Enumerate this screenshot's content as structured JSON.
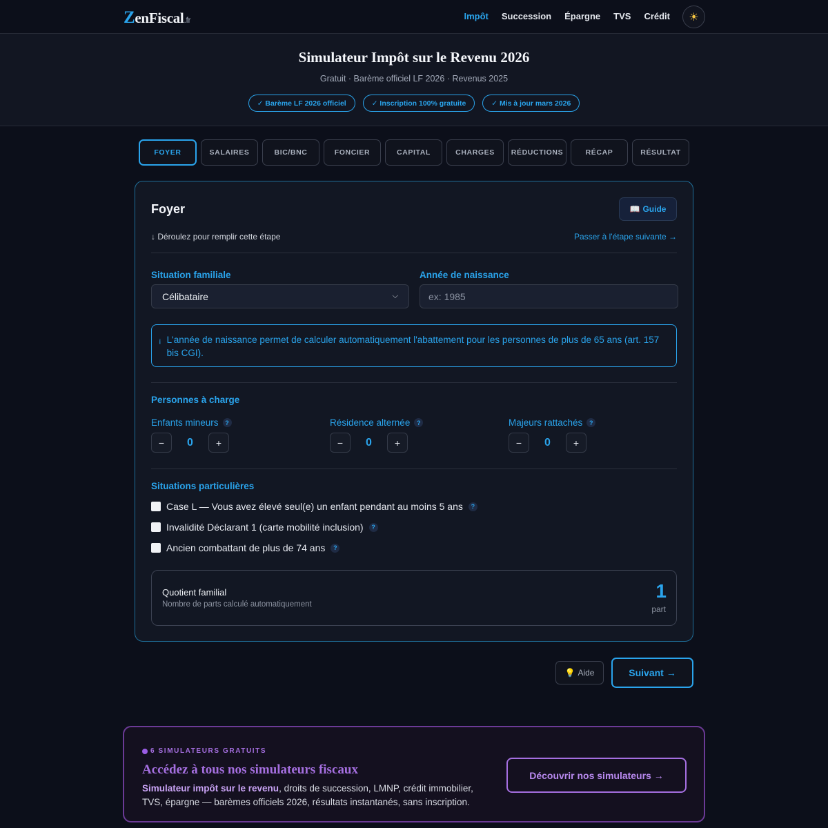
{
  "nav": {
    "logo_z": "Z",
    "logo_rest": "enFiscal",
    "logo_tld": ".fr",
    "links": [
      "Impôt",
      "Succession",
      "Épargne",
      "TVS",
      "Crédit"
    ],
    "active_link": "Impôt",
    "theme_icon": "sun-icon"
  },
  "hero": {
    "title": "Simulateur Impôt sur le Revenu 2026",
    "subtitle": "Gratuit · Barème officiel LF 2026 · Revenus 2025",
    "badges": [
      "✓ Barème LF 2026 officiel",
      "✓ Inscription 100% gratuite",
      "✓ Mis à jour mars 2026"
    ]
  },
  "tabs": [
    "FOYER",
    "SALAIRES",
    "BIC/BNC",
    "FONCIER",
    "CAPITAL",
    "CHARGES",
    "RÉDUCTIONS",
    "RÉCAP",
    "RÉSULTAT"
  ],
  "active_tab": "FOYER",
  "card": {
    "title": "Foyer",
    "guide_label": "Guide",
    "hint": "↓ Déroulez pour remplir cette étape",
    "next_link": "Passer à l'étape suivante →",
    "situation_label": "Situation familiale",
    "situation_value": "Célibataire",
    "birth_label": "Année de naissance",
    "birth_placeholder": "ex: 1985",
    "info_text": "L'année de naissance permet de calculer automatiquement l'abattement pour les personnes de plus de 65 ans (art. 157 bis CGI).",
    "dependents_title": "Personnes à charge",
    "counters": [
      {
        "label": "Enfants mineurs",
        "value": "0"
      },
      {
        "label": "Résidence alternée",
        "value": "0"
      },
      {
        "label": "Majeurs rattachés",
        "value": "0"
      }
    ],
    "special_title": "Situations particulières",
    "checks": [
      "Case L — Vous avez élevé seul(e) un enfant pendant au moins 5 ans",
      "Invalidité Déclarant 1 (carte mobilité inclusion)",
      "Ancien combattant de plus de 74 ans"
    ],
    "qf_title": "Quotient familial",
    "qf_sub": "Nombre de parts calculé automatiquement",
    "qf_value": "1",
    "qf_unit": "part"
  },
  "buttons": {
    "aide": "Aide",
    "suivant": "Suivant →"
  },
  "promo": {
    "eyebrow": "6 SIMULATEURS GRATUITS",
    "title": "Accédez à tous nos simulateurs fiscaux",
    "text_bold": "Simulateur impôt sur le revenu",
    "text_rest": ", droits de succession, LMNP, crédit immobilier, TVS, épargne — barèmes officiels 2026, résultats instantanés, sans inscription.",
    "button": "Découvrir nos simulateurs →"
  },
  "colors": {
    "accent": "#2aa4ec",
    "background": "#0c0f1a",
    "promo_accent": "#a56fe0"
  }
}
